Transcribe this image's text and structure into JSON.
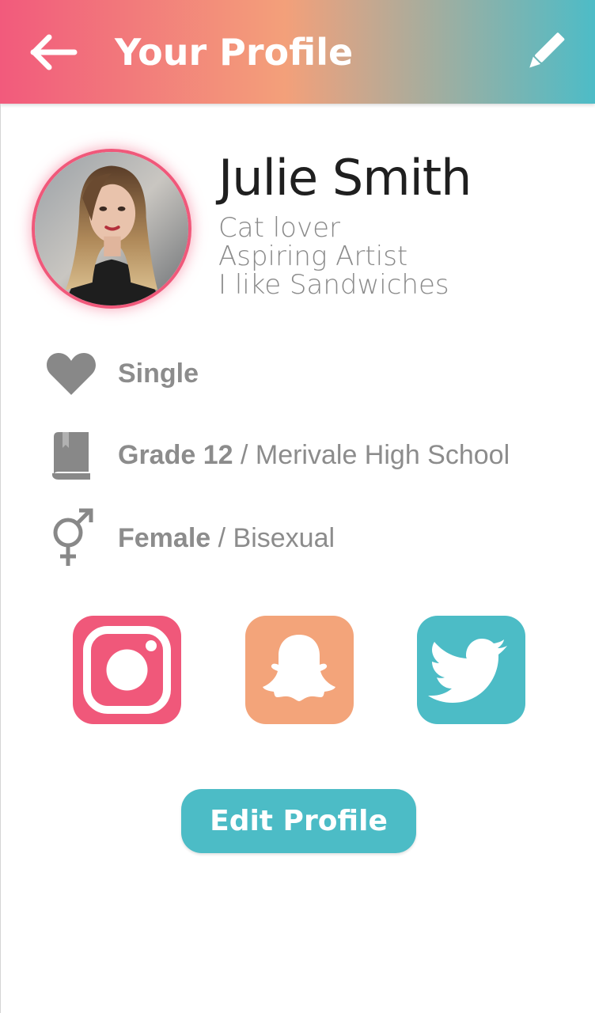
{
  "header": {
    "title": "Your Profile",
    "back_icon": "arrow-left-icon",
    "edit_icon": "pencil-icon",
    "gradient": [
      "#f25a7c",
      "#f3a07a",
      "#4dbcc7"
    ]
  },
  "profile": {
    "name": "Julie Smith",
    "bio": [
      "Cat lover",
      "Aspiring Artist",
      "I like Sandwiches"
    ],
    "avatar_border_color": "#f0587a"
  },
  "details": [
    {
      "icon": "heart-icon",
      "primary": "Single",
      "separator": "",
      "secondary": ""
    },
    {
      "icon": "book-icon",
      "primary": "Grade 12",
      "separator": " / ",
      "secondary": "Merivale High School"
    },
    {
      "icon": "gender-icon",
      "primary": "Female",
      "separator": " / ",
      "secondary": "Bisexual"
    }
  ],
  "social": [
    {
      "name": "instagram",
      "icon": "instagram-icon",
      "color": "#f0587a"
    },
    {
      "name": "snapchat",
      "icon": "snapchat-icon",
      "color": "#f3a47a"
    },
    {
      "name": "twitter",
      "icon": "twitter-icon",
      "color": "#4cbcc6"
    }
  ],
  "actions": {
    "edit_profile_label": "Edit Profile",
    "accent": "#4cbcc6"
  }
}
